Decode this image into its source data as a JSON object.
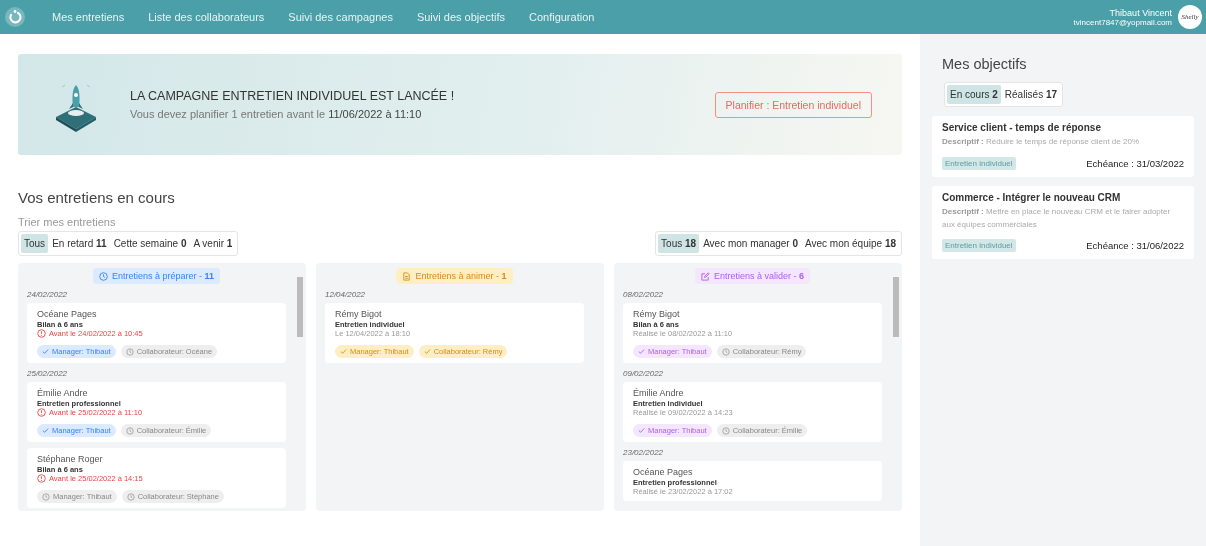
{
  "nav": {
    "items": [
      {
        "label": "Mes entretiens"
      },
      {
        "label": "Liste des collaborateurs"
      },
      {
        "label": "Suivi des campagnes"
      },
      {
        "label": "Suivi des objectifs"
      },
      {
        "label": "Configuration"
      }
    ],
    "user": {
      "name": "Thibaut Vincent",
      "email": "tvincent7847@yopmail.com",
      "avatar_text": "Shelly"
    }
  },
  "banner": {
    "title": "LA CAMPAGNE ENTRETIEN INDIVIDUEL EST LANCÉE !",
    "message": "Vous devez planifier 1 entretien avant le **11/06/2022 à 11:10**",
    "button": "Planifier : Entretien individuel"
  },
  "section_title": "Vos entretiens en cours",
  "sort_label": "Trier mes entretiens",
  "period_filters": [
    {
      "label": "Tous",
      "selected": true
    },
    {
      "label": "En retard",
      "count": "11",
      "selected": false
    },
    {
      "label": "Cette semaine",
      "count": "0",
      "selected": false
    },
    {
      "label": "A venir",
      "count": "1",
      "selected": false
    }
  ],
  "scope_filters": [
    {
      "label": "Tous",
      "count": "18",
      "selected": true
    },
    {
      "label": "Avec mon manager",
      "count": "0",
      "selected": false
    },
    {
      "label": "Avec mon équipe",
      "count": "18",
      "selected": false
    }
  ],
  "columns": [
    {
      "kind": "prepare",
      "title": "Entretiens à préparer -",
      "count": "11",
      "scrollbar": true,
      "groups": [
        {
          "date": "24/02/2022",
          "cards": [
            {
              "name": "Océane Pages",
              "type": "Bilan à 6 ans",
              "when": "Avant le 24/02/2022 à 10:45",
              "late": true,
              "tags": [
                {
                  "label": "Manager: Thibaut",
                  "done": true
                },
                {
                  "label": "Collaborateur: Océane",
                  "done": false
                }
              ]
            }
          ]
        },
        {
          "date": "25/02/2022",
          "cards": [
            {
              "name": "Émilie Andre",
              "type": "Entretien professionnel",
              "when": "Avant le 25/02/2022 à 11:10",
              "late": true,
              "tags": [
                {
                  "label": "Manager: Thibaut",
                  "done": true
                },
                {
                  "label": "Collaborateur: Émilie",
                  "done": false
                }
              ]
            },
            {
              "name": "Stéphane Roger",
              "type": "Bilan à 6 ans",
              "when": "Avant le 25/02/2022 à 14:15",
              "late": true,
              "tags": [
                {
                  "label": "Manager: Thibaut",
                  "done": false
                },
                {
                  "label": "Collaborateur: Stéphane",
                  "done": false
                }
              ]
            }
          ]
        }
      ]
    },
    {
      "kind": "animate",
      "title": "Entretiens à animer -",
      "count": "1",
      "scrollbar": false,
      "groups": [
        {
          "date": "12/04/2022",
          "cards": [
            {
              "name": "Rémy Bigot",
              "type": "Entretien individuel",
              "when": "Le 12/04/2022 à 18:10",
              "late": false,
              "tags": [
                {
                  "label": "Manager: Thibaut",
                  "done": true
                },
                {
                  "label": "Collaborateur: Rémy",
                  "done": true
                }
              ]
            }
          ]
        }
      ]
    },
    {
      "kind": "validate",
      "title": "Entretiens à valider -",
      "count": "6",
      "scrollbar": true,
      "groups": [
        {
          "date": "08/02/2022",
          "cards": [
            {
              "name": "Rémy Bigot",
              "type": "Bilan à 6 ans",
              "when": "Réalisé le 08/02/2022 à 11:10",
              "late": false,
              "tags": [
                {
                  "label": "Manager: Thibaut",
                  "done": true
                },
                {
                  "label": "Collaborateur: Rémy",
                  "done": false
                }
              ]
            }
          ]
        },
        {
          "date": "09/02/2022",
          "cards": [
            {
              "name": "Émilie Andre",
              "type": "Entretien individuel",
              "when": "Réalisé le 09/02/2022 à 14:23",
              "late": false,
              "tags": [
                {
                  "label": "Manager: Thibaut",
                  "done": true
                },
                {
                  "label": "Collaborateur: Émilie",
                  "done": false
                }
              ]
            }
          ]
        },
        {
          "date": "23/02/2022",
          "cards": [
            {
              "name": "Océane Pages",
              "type": "Entretien professionnel",
              "when": "Réalisé le 23/02/2022 à 17:02",
              "late": false
            }
          ]
        }
      ]
    }
  ],
  "objectives": {
    "title": "Mes objectifs",
    "tabs": [
      {
        "label": "En cours",
        "count": "2",
        "selected": true
      },
      {
        "label": "Réalisés",
        "count": "17",
        "selected": false
      }
    ],
    "items": [
      {
        "title": "Service client - temps de réponse",
        "description_label": "Descriptif :",
        "description": "Réduire le temps de réponse client de 20%",
        "tag": "Entretien individuel",
        "due": "Echéance : 31/03/2022"
      },
      {
        "title": "Commerce - Intégrer le nouveau CRM",
        "description_label": "Descriptif :",
        "description": "Mettre en place le nouveau CRM et le fairer adopter aux équipes commerciales",
        "tag": "Entretien individuel",
        "due": "Echéance : 31/06/2022"
      }
    ]
  }
}
